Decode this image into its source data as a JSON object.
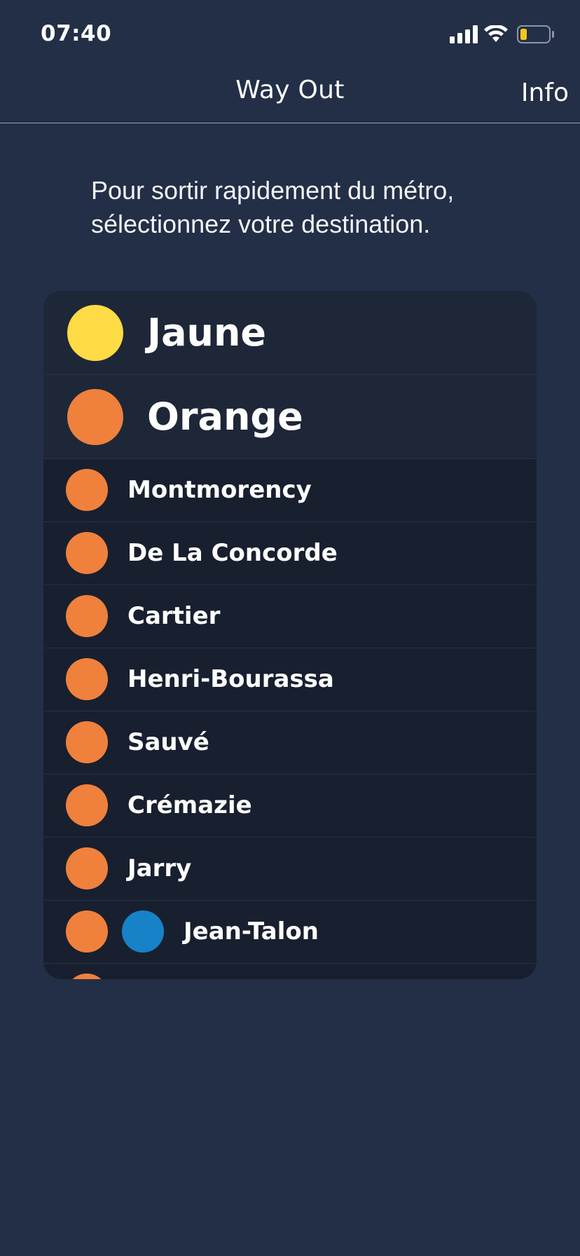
{
  "status_bar": {
    "time": "07:40",
    "icons": [
      "signal-icon",
      "wifi-icon",
      "battery-icon"
    ],
    "battery_color": "#f5c518"
  },
  "nav": {
    "title": "Way Out",
    "info_label": "Info"
  },
  "intro": {
    "line1": "Pour sortir rapidement du métro,",
    "line2": "sélectionnez votre destination."
  },
  "lines": [
    {
      "label": "Jaune",
      "color": "#ffdb45"
    },
    {
      "label": "Orange",
      "color": "#f0813d"
    }
  ],
  "stations": [
    {
      "label": "Montmorency",
      "colors": [
        "#f0813d"
      ]
    },
    {
      "label": "De La Concorde",
      "colors": [
        "#f0813d"
      ]
    },
    {
      "label": "Cartier",
      "colors": [
        "#f0813d"
      ]
    },
    {
      "label": "Henri-Bourassa",
      "colors": [
        "#f0813d"
      ]
    },
    {
      "label": "Sauvé",
      "colors": [
        "#f0813d"
      ]
    },
    {
      "label": "Crémazie",
      "colors": [
        "#f0813d"
      ]
    },
    {
      "label": "Jarry",
      "colors": [
        "#f0813d"
      ]
    },
    {
      "label": "Jean-Talon",
      "colors": [
        "#f0813d",
        "#1782c7"
      ]
    },
    {
      "label": "",
      "colors": [
        "#f0813d"
      ]
    }
  ]
}
